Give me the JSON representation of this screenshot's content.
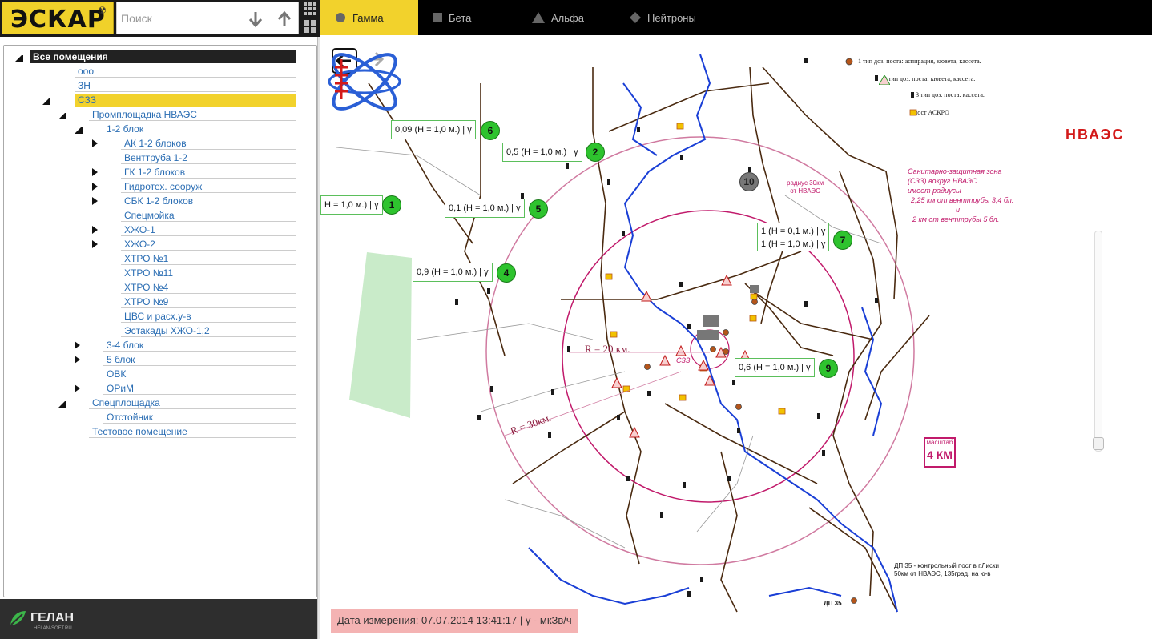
{
  "app": {
    "logo_text": "ЭСКАР",
    "logo_symbol": "☢",
    "search_placeholder": "Поиск"
  },
  "tabs": [
    {
      "label": "Гамма",
      "icon": "circle-icon",
      "active": true
    },
    {
      "label": "Бета",
      "icon": "square-icon",
      "active": false
    },
    {
      "label": "Альфа",
      "icon": "triangle-icon",
      "active": false
    },
    {
      "label": "Нейтроны",
      "icon": "diamond-icon",
      "active": false
    }
  ],
  "tree": [
    {
      "label": "Все помещения",
      "depth": 0,
      "toggle": "open",
      "selected": "dark"
    },
    {
      "label": "ооо",
      "depth": 1,
      "toggle": "none"
    },
    {
      "label": "ЗН",
      "depth": 1,
      "toggle": "none"
    },
    {
      "label": "СЗЗ",
      "depth": 1,
      "toggle": "open",
      "selected": "yellow"
    },
    {
      "label": "Промплощадка НВАЭС",
      "depth": 2,
      "toggle": "open"
    },
    {
      "label": "1-2 блок",
      "depth": 3,
      "toggle": "open"
    },
    {
      "label": "АК 1-2 блоков",
      "depth": 4,
      "toggle": "closed"
    },
    {
      "label": "Венттруба 1-2",
      "depth": 4,
      "toggle": "none"
    },
    {
      "label": "ГК 1-2 блоков",
      "depth": 4,
      "toggle": "closed"
    },
    {
      "label": "Гидротех. сооруж",
      "depth": 4,
      "toggle": "closed"
    },
    {
      "label": "СБК 1-2 блоков",
      "depth": 4,
      "toggle": "closed"
    },
    {
      "label": "Спецмойка",
      "depth": 4,
      "toggle": "none"
    },
    {
      "label": "ХЖО-1",
      "depth": 4,
      "toggle": "closed"
    },
    {
      "label": "ХЖО-2",
      "depth": 4,
      "toggle": "closed"
    },
    {
      "label": "ХТРО №1",
      "depth": 4,
      "toggle": "none"
    },
    {
      "label": "ХТРО №11",
      "depth": 4,
      "toggle": "none"
    },
    {
      "label": "ХТРО №4",
      "depth": 4,
      "toggle": "none"
    },
    {
      "label": "ХТРО №9",
      "depth": 4,
      "toggle": "none"
    },
    {
      "label": "ЦВС и расх.у-в",
      "depth": 4,
      "toggle": "none"
    },
    {
      "label": "Эстакады ХЖО-1,2",
      "depth": 4,
      "toggle": "none"
    },
    {
      "label": "3-4 блок",
      "depth": 3,
      "toggle": "closed"
    },
    {
      "label": "5 блок",
      "depth": 3,
      "toggle": "closed"
    },
    {
      "label": "ОВК",
      "depth": 3,
      "toggle": "none"
    },
    {
      "label": "ОРиМ",
      "depth": 3,
      "toggle": "closed"
    },
    {
      "label": "Спецплощадка",
      "depth": 2,
      "toggle": "open"
    },
    {
      "label": "Отстойник",
      "depth": 3,
      "toggle": "none"
    },
    {
      "label": "Тестовое помещение",
      "depth": 2,
      "toggle": "none"
    }
  ],
  "footer": {
    "company": "ГЕЛАН",
    "site": "HELAN-SOFT.RU"
  },
  "map": {
    "labels": [
      {
        "id": "1",
        "text": "Н = 1,0 м.) | γ"
      },
      {
        "id": "2",
        "text": "0,5 (Н = 1,0 м.) | γ"
      },
      {
        "id": "4",
        "text": "0,9 (Н = 1,0 м.) | γ"
      },
      {
        "id": "5",
        "text": "0,1 (Н = 1,0 м.) | γ"
      },
      {
        "id": "6",
        "text": "0,09 (Н = 1,0 м.) | γ"
      },
      {
        "id": "7",
        "text": "1 (Н = 0,1 м.) | γ",
        "text2": "1 (Н = 1,0 м.) | γ"
      },
      {
        "id": "9",
        "text": "0,6 (Н = 1,0 м.) | γ"
      },
      {
        "id": "10",
        "text": ""
      }
    ],
    "legend": [
      "1 тип доз. поста: аспирация, кювета, кассета.",
      "2 тип доз. поста: кювета, кассета.",
      "3 тип доз. поста: кассета.",
      "пост АСКРО"
    ],
    "nvaes_name": "НВАЭС",
    "szz_lines": [
      "Санитарно-защитная зона",
      "(СЗЗ) вокруг НВАЭС",
      "имеет радиусы",
      "2,25 км от венттрубы 3,4 бл.",
      "и",
      "2 км от венттрубы 5 бл."
    ],
    "radius30_lines": [
      "радиус 30км",
      "от НВАЭС"
    ],
    "scale_label": "масштаб",
    "scale_value": "4 КМ",
    "r20": "R = 20 км.",
    "r30": "R = 30км.",
    "szz_mark": "СЗЗ",
    "dp35_lines": [
      "ДП 35 - контрольный пост в г.Лиски",
      "50км от НВАЭС, 135град. на ю-в"
    ],
    "dp35_label": "ДП 35",
    "date_text": "Дата измерения: 07.07.2014 13:41:17 | γ - мкЗв/ч"
  },
  "colors": {
    "accent": "#f2d22c",
    "tree_link": "#2a6db3",
    "circle": "#c11a6b",
    "river": "#1a3fd6",
    "road": "#4a2a10"
  }
}
